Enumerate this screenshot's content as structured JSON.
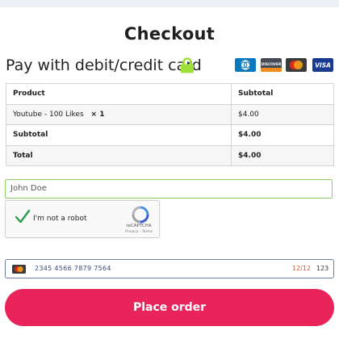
{
  "page": {
    "title": "Checkout"
  },
  "payment": {
    "heading": "Pay with debit/credit card",
    "card_logos": [
      {
        "name": "Diners Club",
        "icon": "diners-icon",
        "color": "#0a79be"
      },
      {
        "name": "Discover",
        "icon": "discover-icon",
        "color": "#444b54"
      },
      {
        "name": "Mastercard",
        "icon": "mastercard-icon",
        "color": "#e5261b"
      },
      {
        "name": "Visa",
        "icon": "visa-icon",
        "color": "#1a3a8f",
        "text": "VISA"
      }
    ],
    "discover_text": "DISCOVER"
  },
  "order_table": {
    "headers": [
      "Product",
      "Subtotal"
    ],
    "item": {
      "product": "Youtube - 100 Likes",
      "qty": "× 1",
      "subtotal": "$4.00"
    },
    "subtotal": {
      "label": "Subtotal",
      "value": "$4.00"
    },
    "total": {
      "label": "Total",
      "value": "$4.00"
    }
  },
  "form": {
    "name_value": "John Doe"
  },
  "recaptcha": {
    "label": "I'm not a robot",
    "brand": "reCAPTCHA",
    "terms": "Privacy - Terms",
    "checked": true
  },
  "card_input": {
    "number": "2345 4566 7879 7564",
    "expiry": "12/12",
    "cvc": "123"
  },
  "actions": {
    "place_order": "Place order"
  },
  "colors": {
    "accent": "#e8245a",
    "lock": "#9ee03a",
    "check": "#2e9b4f",
    "input_border": "#8fcf6a"
  }
}
